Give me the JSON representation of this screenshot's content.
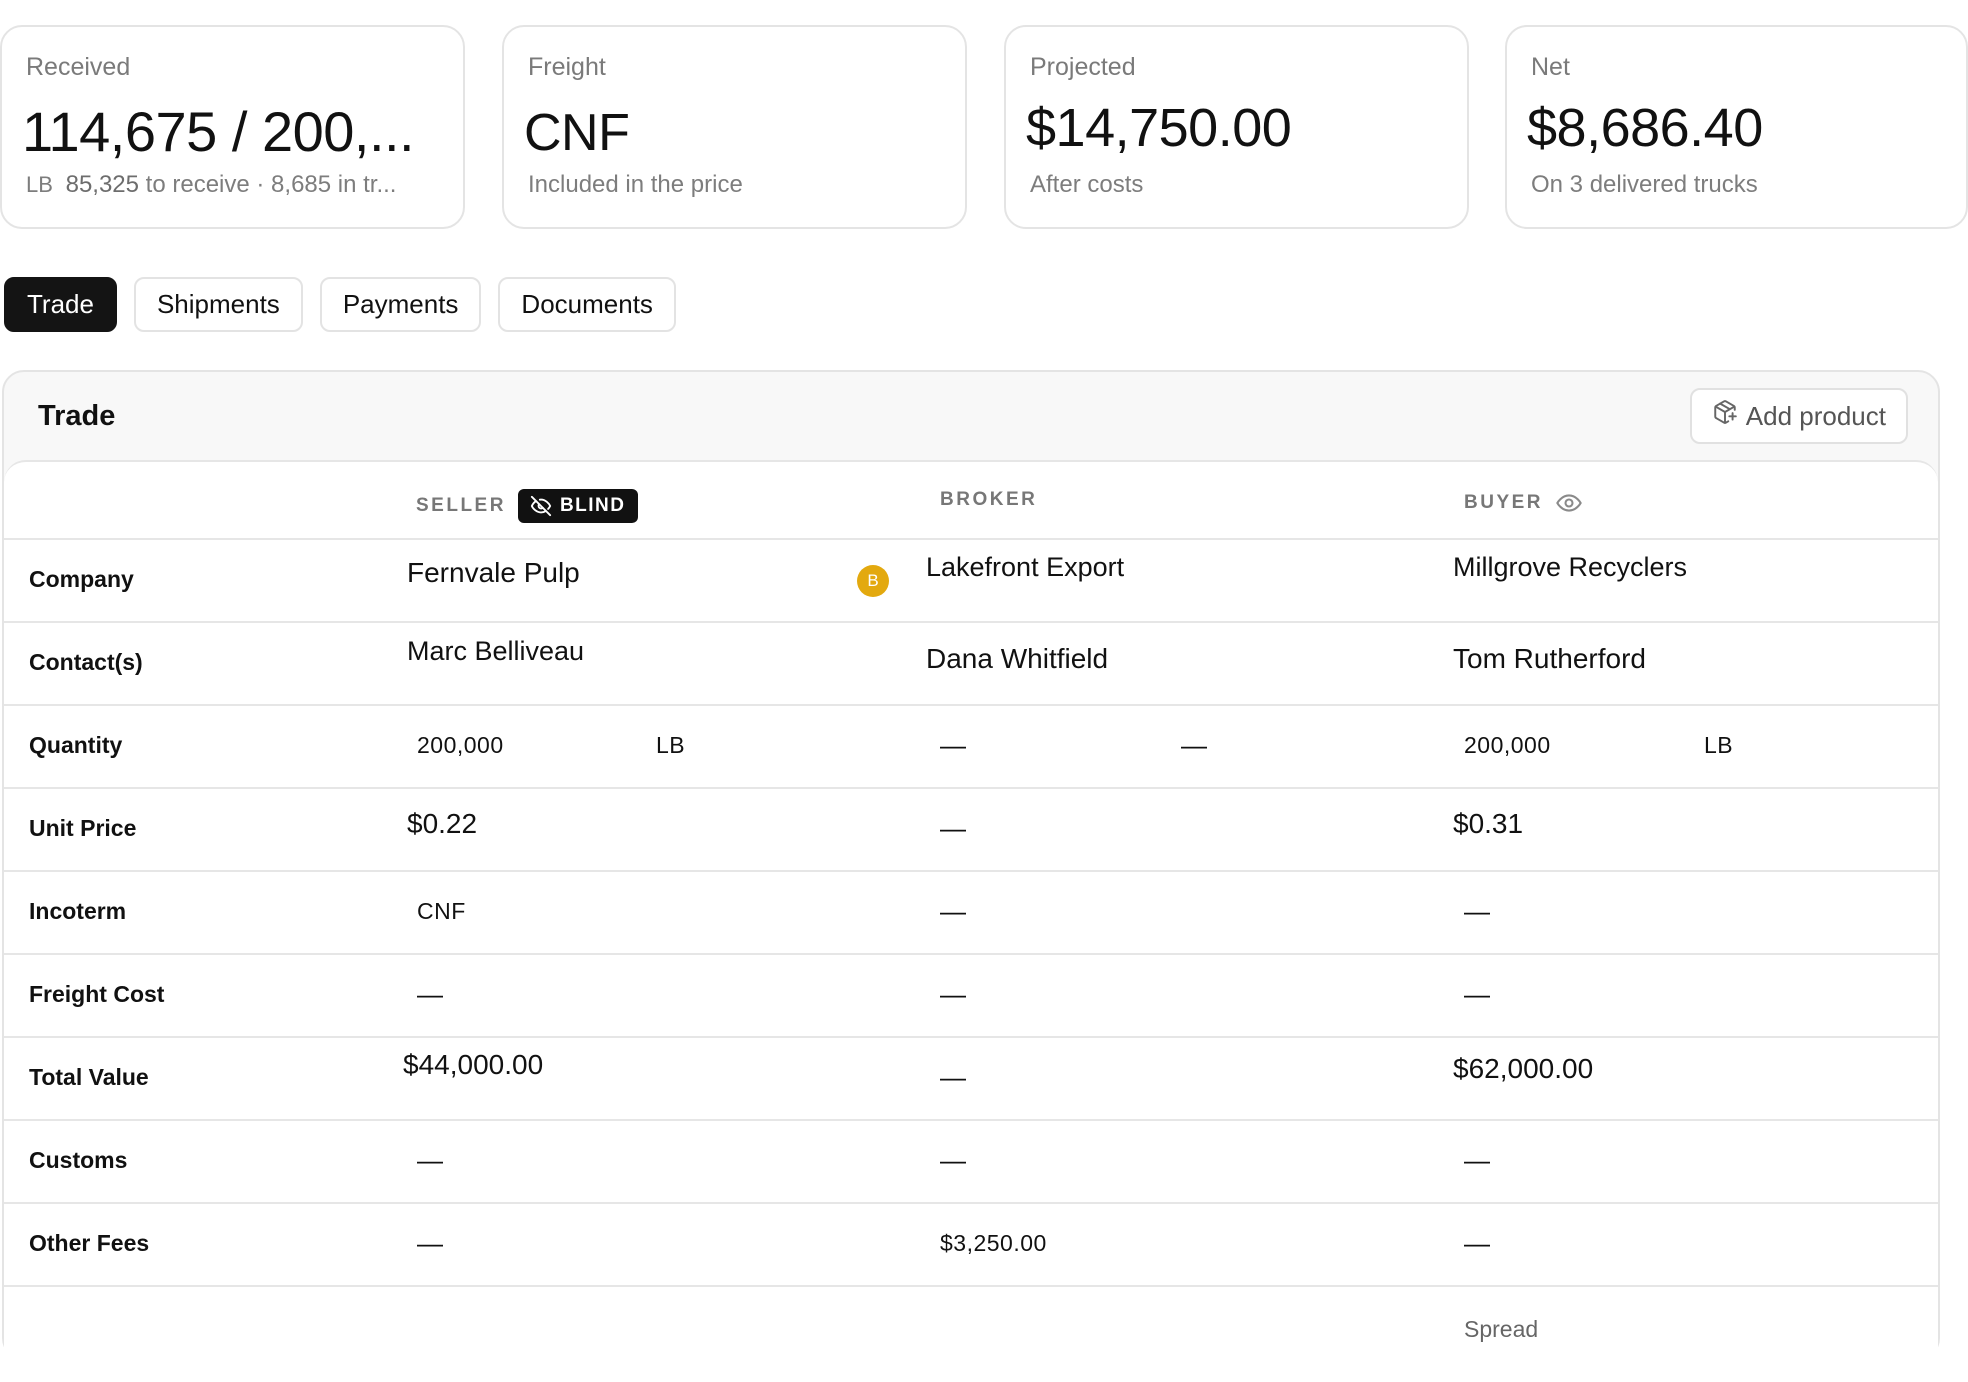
{
  "cards": [
    {
      "label": "Received",
      "value": "114,675 / 200,...",
      "sub_unit": "LB",
      "sub_num": "85,325",
      "sub_text": "to receive · 8,685 in tr..."
    },
    {
      "label": "Freight",
      "value": "CNF",
      "sub_text": "Included in the price"
    },
    {
      "label": "Projected",
      "value": "$14,750.00",
      "sub_text": "After costs"
    },
    {
      "label": "Net",
      "value": "$8,686.40",
      "sub_text": "On 3 delivered trucks"
    }
  ],
  "tabs": [
    "Trade",
    "Shipments",
    "Payments",
    "Documents"
  ],
  "active_tab": "Trade",
  "panel": {
    "title": "Trade",
    "add_button": "Add product"
  },
  "columns": {
    "seller": "SELLER",
    "blind_badge": "BLIND",
    "broker": "BROKER",
    "buyer": "BUYER"
  },
  "rows": {
    "company": {
      "label": "Company",
      "seller": "Fernvale Pulp",
      "broker_avatar": "B",
      "broker": "Lakefront Export",
      "buyer": "Millgrove Recyclers"
    },
    "contacts": {
      "label": "Contact(s)",
      "seller": "Marc Belliveau",
      "broker": "Dana Whitfield",
      "buyer": "Tom Rutherford"
    },
    "quantity": {
      "label": "Quantity",
      "seller_qty": "200,000",
      "seller_unit": "LB",
      "broker_qty": "—",
      "broker_unit": "—",
      "buyer_qty": "200,000",
      "buyer_unit": "LB"
    },
    "unit_price": {
      "label": "Unit Price",
      "seller": "$0.22",
      "broker": "—",
      "buyer": "$0.31"
    },
    "incoterm": {
      "label": "Incoterm",
      "seller": "CNF",
      "broker": "—",
      "buyer": "—"
    },
    "freight_cost": {
      "label": "Freight Cost",
      "seller": "—",
      "broker": "—",
      "buyer": "—"
    },
    "total_value": {
      "label": "Total Value",
      "seller": "$44,000.00",
      "broker": "—",
      "buyer": "$62,000.00"
    },
    "customs": {
      "label": "Customs",
      "seller": "—",
      "broker": "—",
      "buyer": "—"
    },
    "other_fees": {
      "label": "Other Fees",
      "seller": "—",
      "broker": "$3,250.00",
      "buyer": "—"
    }
  },
  "spread_label": "Spread",
  "icons": {
    "add_product": "package-plus-icon",
    "blind": "eye-off-icon",
    "buyer_visibility": "eye-icon"
  },
  "colors": {
    "accent_dark": "#141414",
    "avatar": "#e3a90f",
    "border": "#e4e4e4"
  }
}
